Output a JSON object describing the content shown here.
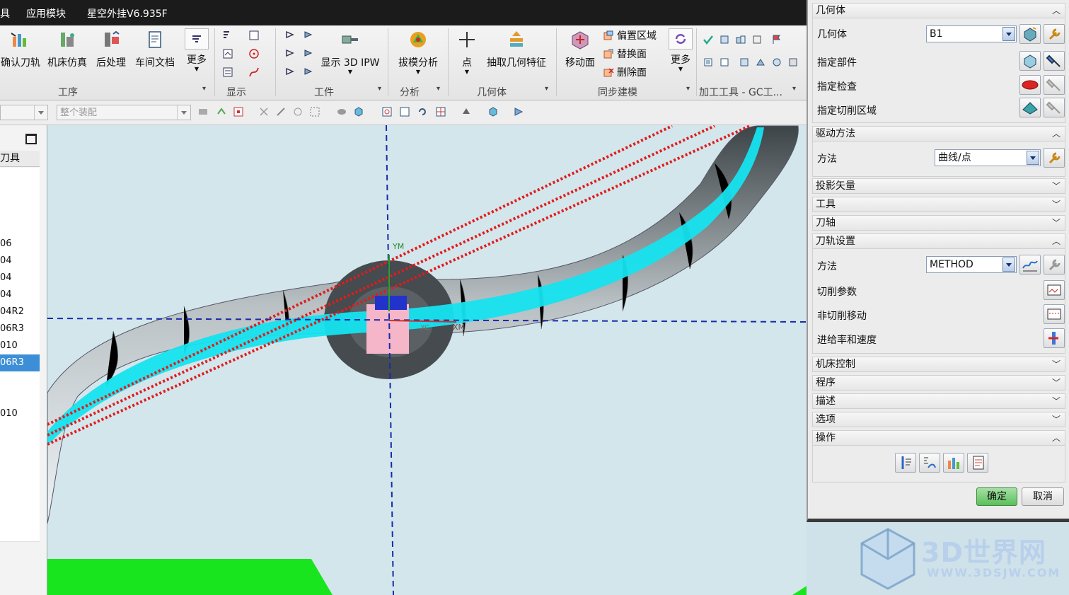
{
  "titlebar": {
    "menu_tool_fragment": "具",
    "menu_app_modules": "应用模块",
    "plugin_name": "星空外挂V6.935F"
  },
  "ribbon": {
    "operation_group": {
      "confirm_toolpath": "确认刀轨",
      "machine_sim": "机床仿真",
      "postprocess": "后处理",
      "shop_docs": "车间文档",
      "more": "更多",
      "label": "工序"
    },
    "display_group": {
      "label": "显示"
    },
    "workpiece_group": {
      "show_3d_ipw": "显示 3D IPW",
      "label": "工件"
    },
    "analysis_group": {
      "draft_analysis": "拔模分析",
      "label": "分析"
    },
    "geometry_group": {
      "point": "点",
      "extract_geometry": "抽取几何特征",
      "label": "几何体"
    },
    "sync_group": {
      "move_face": "移动面",
      "offset_region": "偏置区域",
      "replace_face": "替换面",
      "delete_face": "删除面",
      "more": "更多",
      "label": "同步建模"
    },
    "tools_group": {
      "label": "加工工具 - GC工..."
    }
  },
  "toolbar2": {
    "assembly_filter": "整个装配"
  },
  "navigator": {
    "column_header": "刀具",
    "rows": [
      "",
      "",
      "",
      "",
      "06",
      "04",
      "04",
      "04",
      "04R2",
      "06R3",
      "010",
      "06R3",
      "",
      "",
      "010",
      "",
      "",
      "",
      "",
      "",
      "",
      ""
    ],
    "selected_index": 11
  },
  "viewport": {
    "axis_ym": "YM",
    "axis_xm": "XM",
    "axis_xc": "XC"
  },
  "dialog": {
    "geometry": {
      "header": "几何体",
      "geometry_label": "几何体",
      "geometry_value": "B1",
      "specify_part": "指定部件",
      "specify_check": "指定检查",
      "specify_cut_region": "指定切削区域"
    },
    "drive_method": {
      "header": "驱动方法",
      "method_label": "方法",
      "method_value": "曲线/点"
    },
    "projection_vector": "投影矢量",
    "tool": "工具",
    "tool_axis": "刀轴",
    "path_settings": {
      "header": "刀轨设置",
      "method_label": "方法",
      "method_value": "METHOD",
      "cut_params": "切削参数",
      "non_cut_moves": "非切削移动",
      "feeds_speeds": "进给率和速度"
    },
    "machine_control": "机床控制",
    "program": "程序",
    "description": "描述",
    "options": "选项",
    "actions": "操作",
    "ok": "确定",
    "cancel": "取消"
  },
  "watermark": {
    "brand": "3D世界网",
    "url": "WWW.3DSJW.COM"
  },
  "colors": {
    "accent_blue": "#3c8fd6",
    "tube": "#9aa3a8",
    "cyan_path": "#15e3ef",
    "red_line": "#e21b1b",
    "green_part": "#18e51e",
    "ok_green": "#4aa84a"
  }
}
